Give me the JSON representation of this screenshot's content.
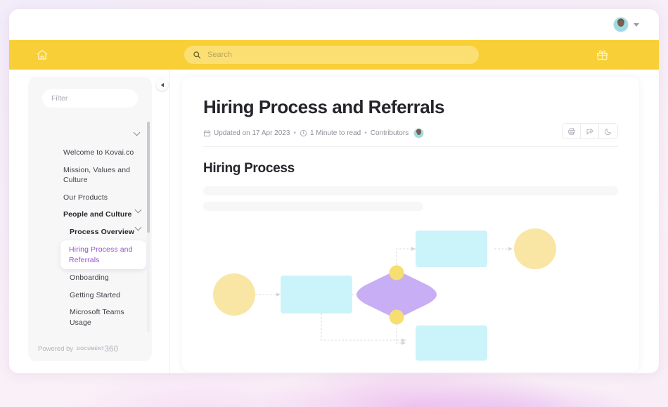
{
  "topbar": {
    "avatar_name": "avatar",
    "chevron": "chevron-down-icon"
  },
  "navbar": {
    "home_icon": "home-icon",
    "gift_icon": "gift-icon",
    "search_icon": "search-icon",
    "search_placeholder": "Search",
    "search_value": "",
    "accent_color": "#f8cf36",
    "search_field_color": "#fbdf73"
  },
  "sidebar": {
    "filter_placeholder": "Filter",
    "filter_value": "",
    "collapse_icon": "chevron-left-icon",
    "group_toggle_icon": "chevron-down-icon",
    "items": [
      {
        "label": "Welcome to Kovai.co",
        "level": 1,
        "bold": false,
        "active": false,
        "chevron": false
      },
      {
        "label": "Mission, Values and Culture",
        "level": 1,
        "bold": false,
        "active": false,
        "chevron": false
      },
      {
        "label": "Our Products",
        "level": 1,
        "bold": false,
        "active": false,
        "chevron": false
      },
      {
        "label": "People and Culture",
        "level": 1,
        "bold": true,
        "active": false,
        "chevron": true
      },
      {
        "label": "Process Overview",
        "level": 2,
        "bold": true,
        "active": false,
        "chevron": true
      },
      {
        "label": "Hiring Process and Referrals",
        "level": 2,
        "bold": false,
        "active": true,
        "chevron": false
      },
      {
        "label": "Onboarding",
        "level": 2,
        "bold": false,
        "active": false,
        "chevron": false
      },
      {
        "label": "Getting Started",
        "level": 2,
        "bold": false,
        "active": false,
        "chevron": false
      },
      {
        "label": "Microsoft Teams Usage",
        "level": 2,
        "bold": false,
        "active": false,
        "chevron": false
      }
    ],
    "active_color": "#9a4fd0",
    "footer": {
      "powered_by": "Powered by",
      "logo_prefix": "DOCUMENT",
      "logo_number": "360"
    }
  },
  "article": {
    "title": "Hiring Process and Referrals",
    "meta": {
      "calendar_icon": "calendar-icon",
      "updated": "Updated on 17 Apr 2023",
      "sep1": "•",
      "clock_icon": "clock-icon",
      "read_time": "1 Minute to read",
      "sep2": "•",
      "contributors_label": "Contributors",
      "contributor_avatar": "avatar"
    },
    "actions": [
      {
        "name": "print-icon",
        "title": "Print"
      },
      {
        "name": "share-icon",
        "title": "Share"
      },
      {
        "name": "moon-icon",
        "title": "Dark mode"
      }
    ],
    "section_title": "Hiring Process",
    "placeholder_lines": 2
  },
  "flowchart": {
    "type": "diagram",
    "note": "Unlabeled flowchart skeleton",
    "colors": {
      "terminator": "#fae6a4",
      "process": "#cbf3fa",
      "decision": "#c8aef5",
      "connector_dot": "#f7de72",
      "arrow": "#d8d8dc"
    },
    "nodes": [
      {
        "id": "start",
        "shape": "circle",
        "color": "#fae6a4"
      },
      {
        "id": "step1",
        "shape": "rect",
        "color": "#cbf3fa"
      },
      {
        "id": "decision",
        "shape": "diamond",
        "color": "#c8aef5"
      },
      {
        "id": "dot-top",
        "shape": "dot",
        "color": "#f7de72"
      },
      {
        "id": "dot-bottom",
        "shape": "dot",
        "color": "#f7de72"
      },
      {
        "id": "step2",
        "shape": "rect",
        "color": "#cbf3fa"
      },
      {
        "id": "end",
        "shape": "circle",
        "color": "#fae6a4"
      },
      {
        "id": "step3",
        "shape": "rect",
        "color": "#cbf3fa"
      }
    ],
    "edges": [
      {
        "from": "start",
        "to": "step1"
      },
      {
        "from": "step1",
        "to": "decision"
      },
      {
        "from": "decision",
        "to": "dot-top"
      },
      {
        "from": "dot-top",
        "to": "step2"
      },
      {
        "from": "step2",
        "to": "end"
      },
      {
        "from": "decision",
        "to": "dot-bottom"
      },
      {
        "from": "dot-bottom",
        "to": "step3"
      },
      {
        "from": "step1",
        "to": "step3"
      }
    ]
  }
}
